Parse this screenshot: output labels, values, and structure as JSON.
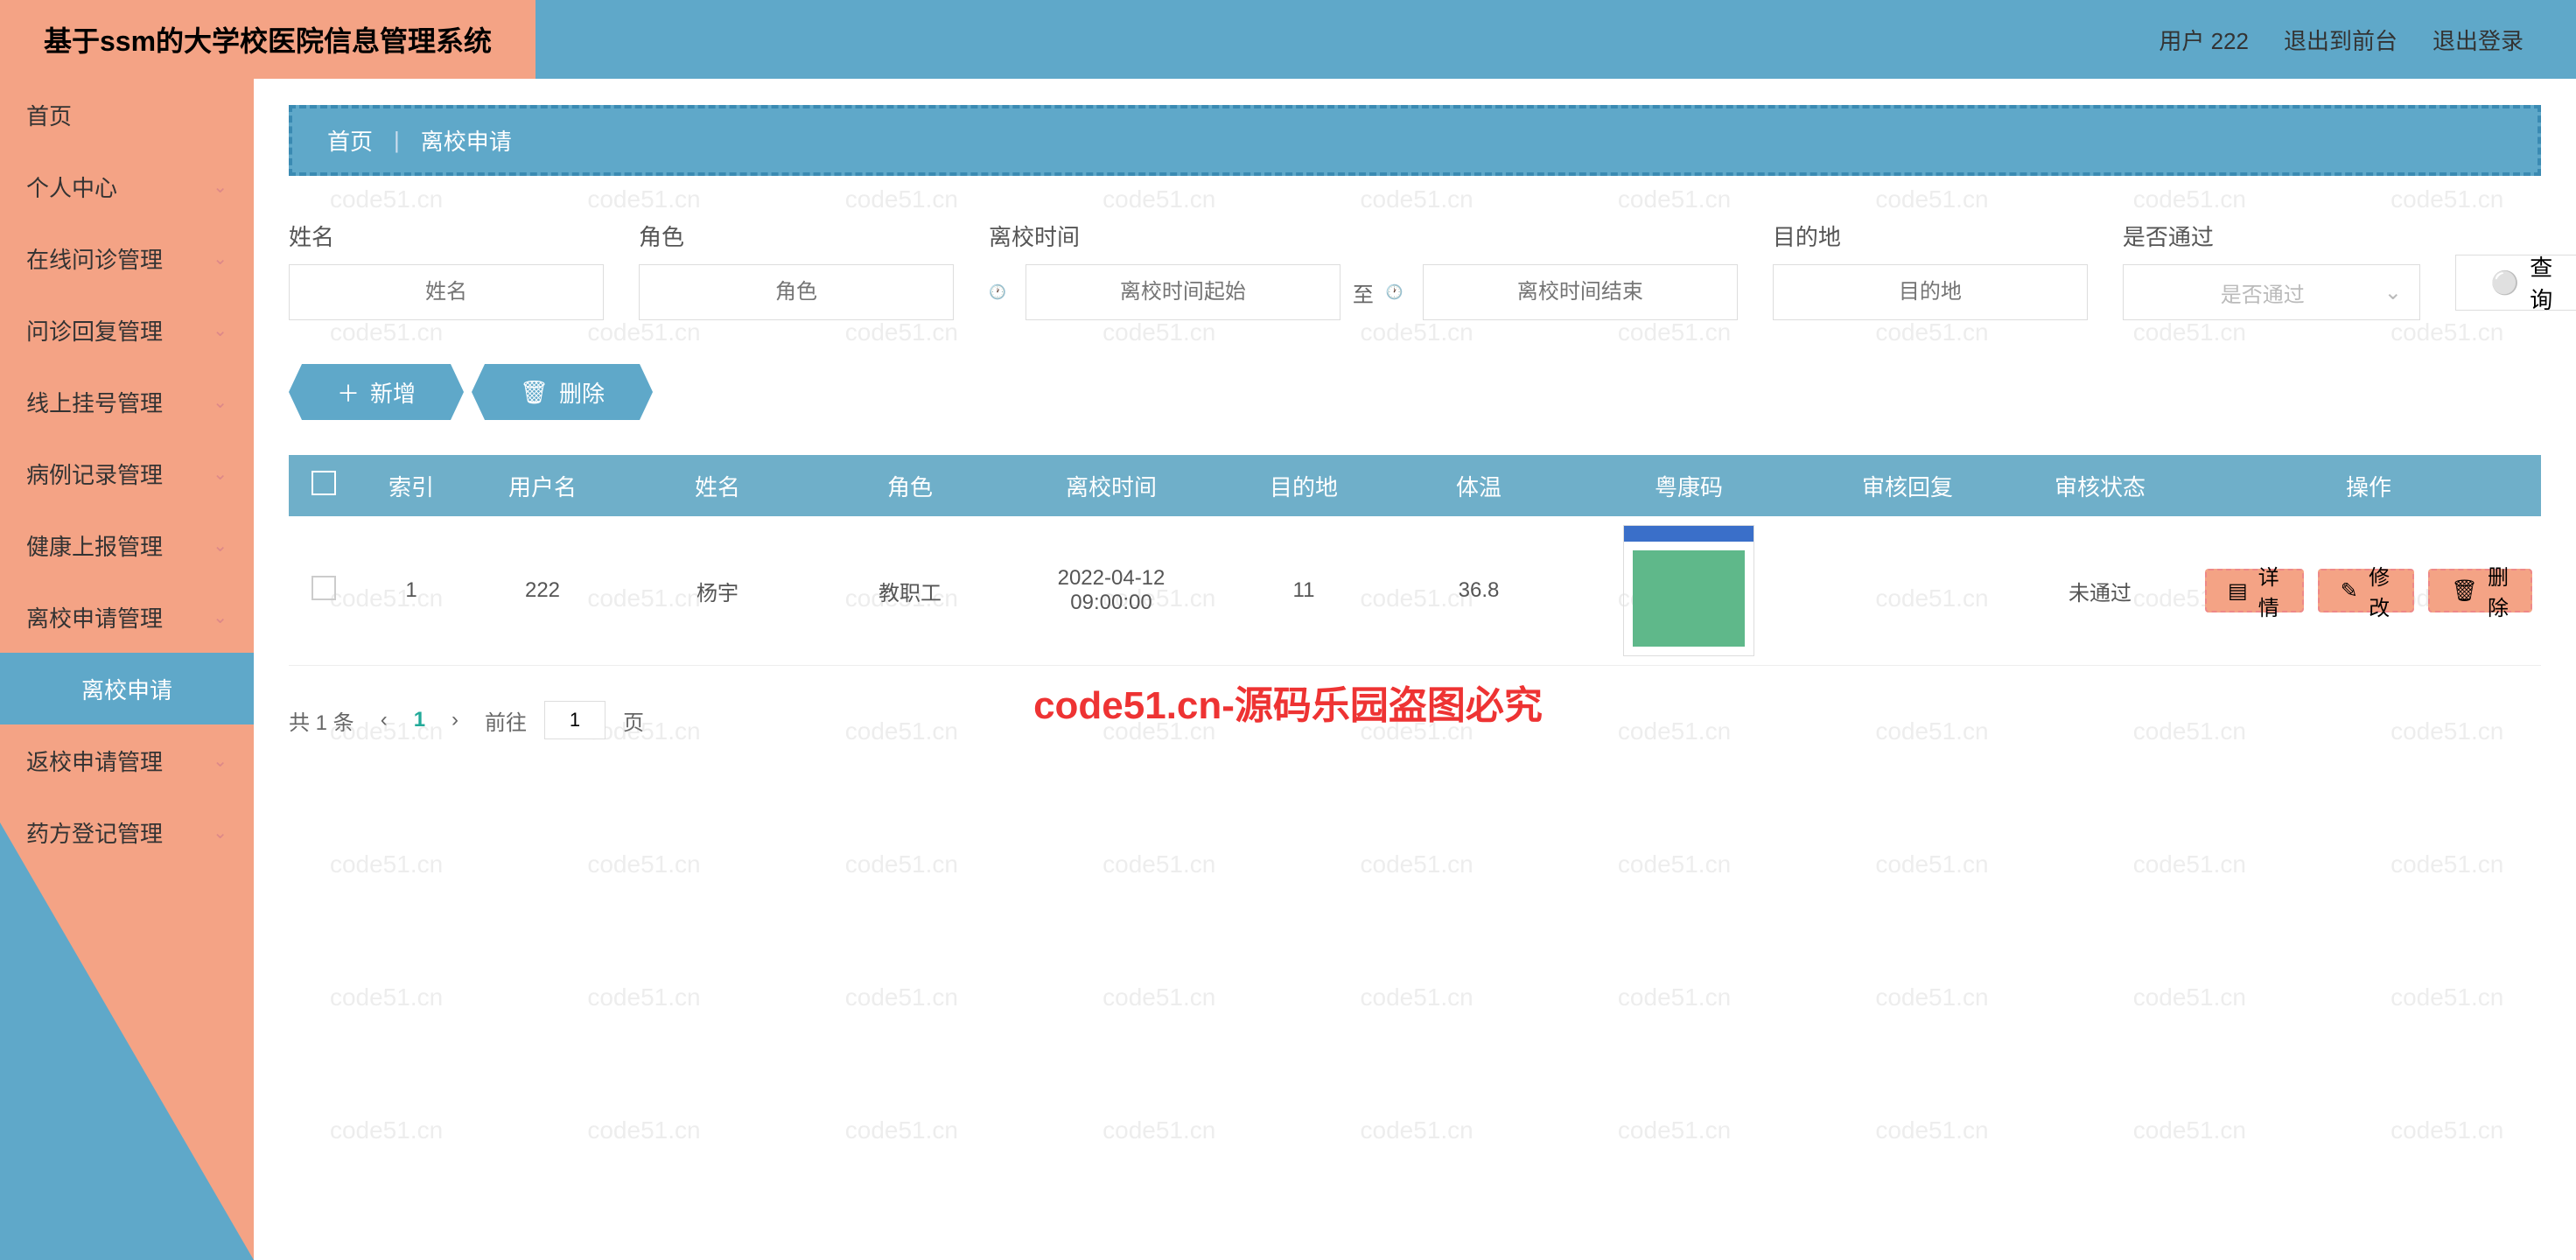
{
  "header": {
    "title": "基于ssm的大学校医院信息管理系统",
    "user_label": "用户 222",
    "back_label": "退出到前台",
    "logout_label": "退出登录"
  },
  "sidebar": {
    "items": [
      {
        "label": "首页",
        "has_sub": false
      },
      {
        "label": "个人中心",
        "has_sub": true
      },
      {
        "label": "在线问诊管理",
        "has_sub": true
      },
      {
        "label": "问诊回复管理",
        "has_sub": true
      },
      {
        "label": "线上挂号管理",
        "has_sub": true
      },
      {
        "label": "病例记录管理",
        "has_sub": true
      },
      {
        "label": "健康上报管理",
        "has_sub": true
      },
      {
        "label": "离校申请管理",
        "has_sub": true,
        "submenu": "离校申请",
        "expanded": true
      },
      {
        "label": "返校申请管理",
        "has_sub": true
      },
      {
        "label": "药方登记管理",
        "has_sub": true
      }
    ]
  },
  "breadcrumb": {
    "home": "首页",
    "current": "离校申请"
  },
  "filters": {
    "name_label": "姓名",
    "name_ph": "姓名",
    "role_label": "角色",
    "role_ph": "角色",
    "time_label": "离校时间",
    "time_start_ph": "离校时间起始",
    "time_sep": "至",
    "time_end_ph": "离校时间结束",
    "dest_label": "目的地",
    "dest_ph": "目的地",
    "pass_label": "是否通过",
    "pass_ph": "是否通过",
    "search_label": "查询"
  },
  "actions": {
    "add": "新增",
    "delete": "删除"
  },
  "table": {
    "headers": {
      "index": "索引",
      "username": "用户名",
      "name": "姓名",
      "role": "角色",
      "leave_time": "离校时间",
      "destination": "目的地",
      "temperature": "体温",
      "health_code": "粤康码",
      "review_reply": "审核回复",
      "review_status": "审核状态",
      "operations": "操作"
    },
    "rows": [
      {
        "index": "1",
        "username": "222",
        "name": "杨宇",
        "role": "教职工",
        "leave_time": "2022-04-12 09:00:00",
        "destination": "11",
        "temperature": "36.8",
        "review_reply": "",
        "review_status": "未通过"
      }
    ],
    "ops": {
      "detail": "详情",
      "edit": "修改",
      "delete": "删除"
    }
  },
  "pagination": {
    "total": "共 1 条",
    "current": "1",
    "goto_prefix": "前往",
    "goto_value": "1",
    "goto_suffix": "页"
  },
  "watermark": "code51.cn",
  "overlay": "code51.cn-源码乐园盗图必究"
}
